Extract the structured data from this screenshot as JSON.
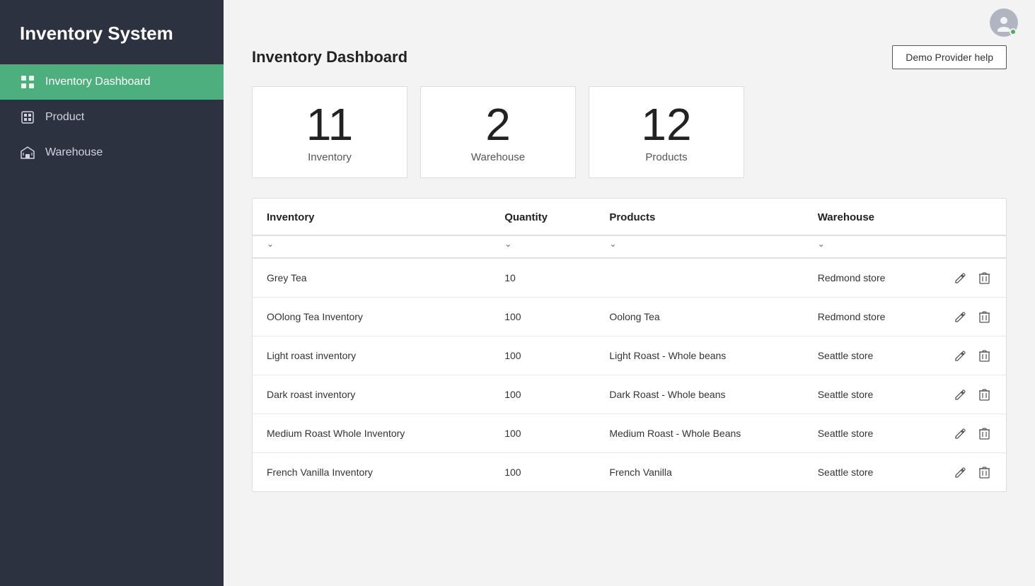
{
  "sidebar": {
    "title": "Inventory System",
    "nav": [
      {
        "id": "dashboard",
        "label": "Inventory Dashboard",
        "active": true,
        "icon": "dashboard-icon"
      },
      {
        "id": "product",
        "label": "Product",
        "active": false,
        "icon": "product-icon"
      },
      {
        "id": "warehouse",
        "label": "Warehouse",
        "active": false,
        "icon": "warehouse-icon"
      }
    ]
  },
  "topbar": {
    "demo_help_label": "Demo Provider help"
  },
  "dashboard": {
    "title": "Inventory Dashboard",
    "stats": [
      {
        "id": "inventory-stat",
        "number": "11",
        "label": "Inventory"
      },
      {
        "id": "warehouse-stat",
        "number": "2",
        "label": "Warehouse"
      },
      {
        "id": "products-stat",
        "number": "12",
        "label": "Products"
      }
    ],
    "table": {
      "columns": [
        "Inventory",
        "Quantity",
        "Products",
        "Warehouse"
      ],
      "rows": [
        {
          "inventory": "Grey Tea",
          "quantity": "10",
          "products": "",
          "warehouse": "Redmond store"
        },
        {
          "inventory": "OOlong Tea Inventory",
          "quantity": "100",
          "products": "Oolong Tea",
          "warehouse": "Redmond store"
        },
        {
          "inventory": "Light roast inventory",
          "quantity": "100",
          "products": "Light Roast - Whole beans",
          "warehouse": "Seattle store"
        },
        {
          "inventory": "Dark roast inventory",
          "quantity": "100",
          "products": "Dark Roast - Whole beans",
          "warehouse": "Seattle store"
        },
        {
          "inventory": "Medium Roast Whole Inventory",
          "quantity": "100",
          "products": "Medium Roast - Whole Beans",
          "warehouse": "Seattle store"
        },
        {
          "inventory": "French Vanilla Inventory",
          "quantity": "100",
          "products": "French Vanilla",
          "warehouse": "Seattle store"
        }
      ]
    }
  }
}
